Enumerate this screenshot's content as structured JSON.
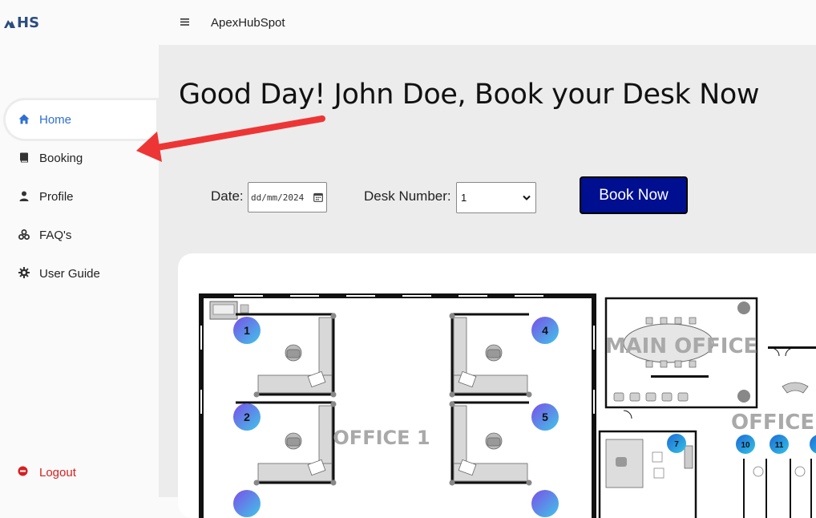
{
  "brand": {
    "logo_text": "HS"
  },
  "header": {
    "app_title": "ApexHubSpot"
  },
  "sidebar": {
    "items": [
      {
        "label": "Home",
        "icon": "home-icon",
        "active": true
      },
      {
        "label": "Booking",
        "icon": "book-icon",
        "active": false
      },
      {
        "label": "Profile",
        "icon": "person-icon",
        "active": false
      },
      {
        "label": "FAQ's",
        "icon": "faq-icon",
        "active": false
      },
      {
        "label": "User Guide",
        "icon": "gear-icon",
        "active": false
      }
    ],
    "logout_label": "Logout"
  },
  "main": {
    "greeting": "Good Day! John Doe, Book your Desk Now",
    "form": {
      "date_label": "Date:",
      "date_placeholder": "dd/mm/2024",
      "desk_label": "Desk Number:",
      "desk_value": "1",
      "book_label": "Book Now"
    },
    "floor_plan": {
      "labels": {
        "office1": "OFFICE 1",
        "main_office": "MAIN OFFICE",
        "office2": "OFFICE"
      },
      "desks": [
        "1",
        "2",
        "4",
        "5",
        "7",
        "10",
        "11"
      ]
    }
  },
  "colors": {
    "accent": "#2f6fd3",
    "button": "#000f8f",
    "logout": "#d62020",
    "annotation_arrow": "#ee3535"
  }
}
